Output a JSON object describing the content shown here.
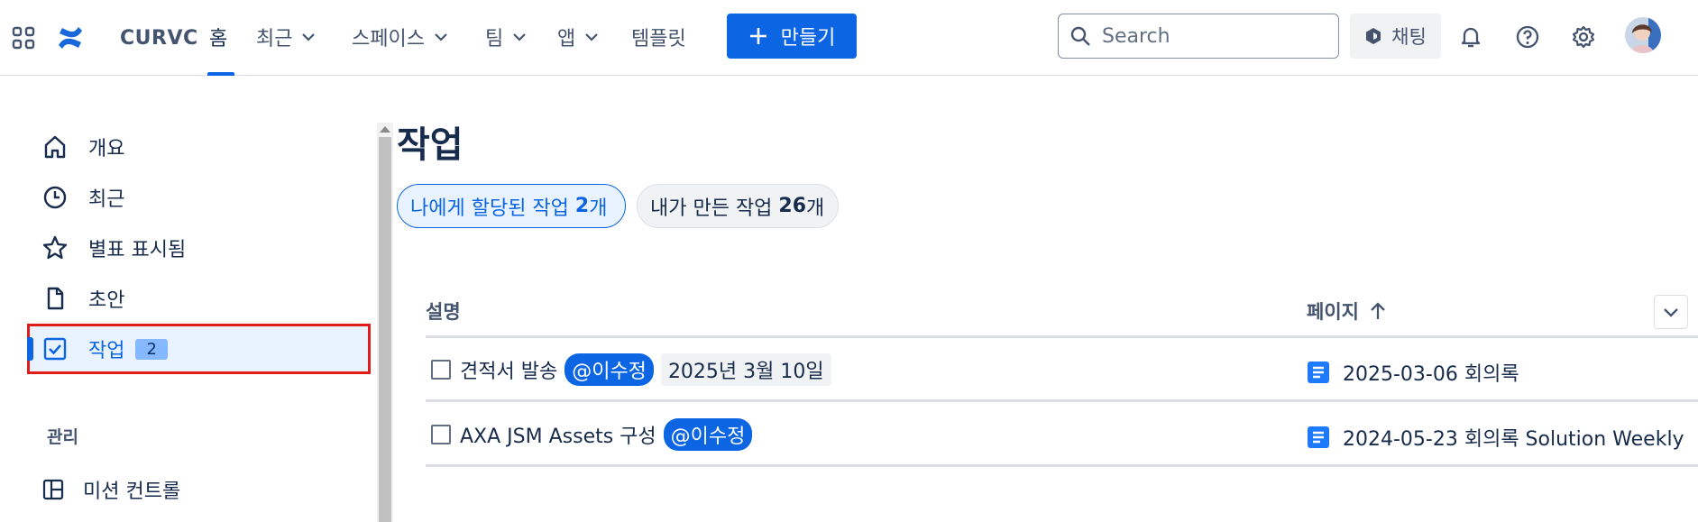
{
  "topbar": {
    "site_name": "CURVC",
    "nav": [
      {
        "label": "홈",
        "active": true
      },
      {
        "label": "최근",
        "dropdown": true
      },
      {
        "label": "스페이스",
        "dropdown": true
      },
      {
        "label": "팀",
        "dropdown": true
      },
      {
        "label": "앱",
        "dropdown": true
      },
      {
        "label": "템플릿"
      }
    ],
    "create_label": "만들기",
    "search_placeholder": "Search",
    "chat_label": "채팅",
    "icons": [
      "apps-grid-icon",
      "confluence-logo-icon",
      "plus-icon",
      "search-icon",
      "rovo-icon",
      "bell-icon",
      "help-icon",
      "gear-icon"
    ],
    "accent_color": "#0c66e4"
  },
  "sidebar": {
    "items": [
      {
        "label": "개요",
        "icon": "home-icon"
      },
      {
        "label": "최근",
        "icon": "clock-icon"
      },
      {
        "label": "별표 표시됨",
        "icon": "star-icon"
      },
      {
        "label": "초안",
        "icon": "draft-page-icon"
      },
      {
        "label": "작업",
        "icon": "task-checkbox-icon",
        "badge": "2",
        "active": true
      }
    ],
    "section_title": "관리",
    "section_items": [
      {
        "label": "미션 컨트롤",
        "icon": "layout-panel-icon"
      }
    ]
  },
  "main": {
    "title": "작업",
    "filters": [
      {
        "label": "나에게 할당된 작업 ",
        "count": "2",
        "suffix": "개",
        "selected": true
      },
      {
        "label": "내가 만든 작업 ",
        "count": "26",
        "suffix": "개",
        "selected": false
      }
    ],
    "columns": {
      "description": "설명",
      "page": "페이지"
    },
    "rows": [
      {
        "task": "견적서 발송",
        "mention": "@이수정",
        "due": "2025년 3월 10일",
        "page": "2025-03-06 회의록"
      },
      {
        "task": "AXA JSM Assets 구성",
        "mention": "@이수정",
        "due": "",
        "page": "2024-05-23 회의록 Solution Weekly"
      }
    ]
  }
}
